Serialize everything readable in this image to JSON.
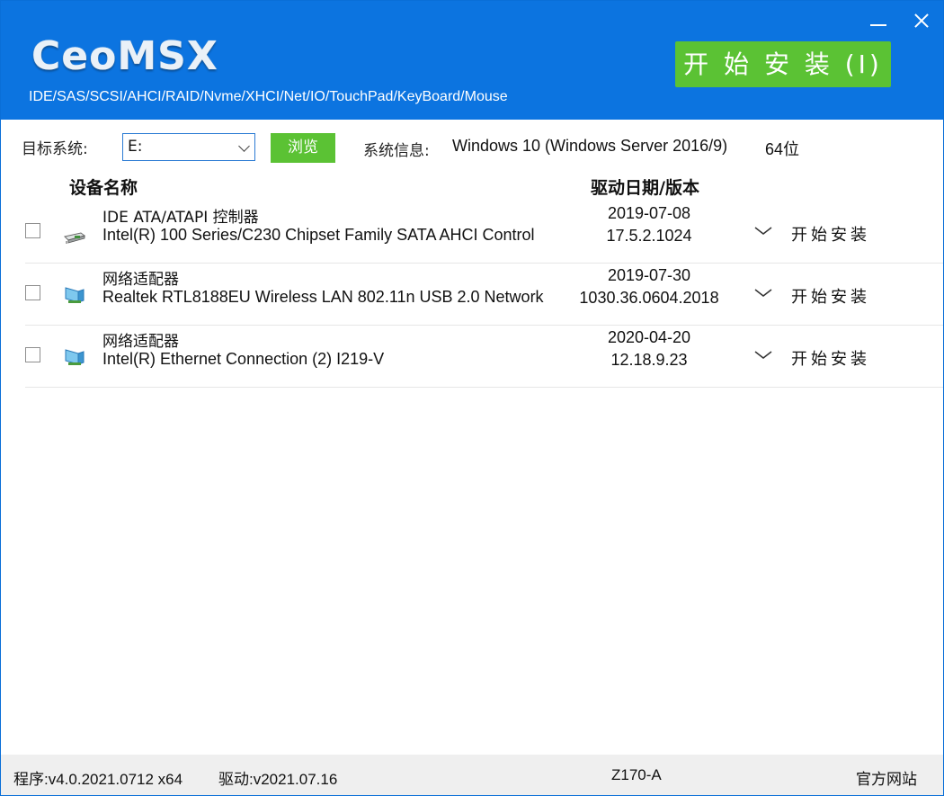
{
  "header": {
    "logo": "CeoMSX",
    "subtitle": "IDE/SAS/SCSI/AHCI/RAID/Nvme/XHCI/Net/IO/TouchPad/KeyBoard/Mouse",
    "install_label": "开 始 安 装 (I)"
  },
  "target": {
    "label": "目标系统:",
    "value": "E:",
    "browse_label": "浏览"
  },
  "system_info": {
    "label": "系统信息:",
    "os": "Windows 10 (Windows Server 2016/9)",
    "arch": "64位"
  },
  "table": {
    "col_name": "设备名称",
    "col_date_version": "驱动日期/版本",
    "rows": [
      {
        "category": "IDE ATA/ATAPI 控制器",
        "device": "Intel(R) 100 Series/C230 Chipset Family SATA AHCI Control",
        "date": "2019-07-08",
        "version": "17.5.2.1024",
        "install_label": "开始安装",
        "icon": "storage-controller-icon"
      },
      {
        "category": "网络适配器",
        "device": "Realtek RTL8188EU Wireless LAN 802.11n USB 2.0 Network",
        "date": "2019-07-30",
        "version": "1030.36.0604.2018",
        "install_label": "开始安装",
        "icon": "network-adapter-icon"
      },
      {
        "category": "网络适配器",
        "device": "Intel(R) Ethernet Connection (2) I219-V",
        "date": "2020-04-20",
        "version": "12.18.9.23",
        "install_label": "开始安装",
        "icon": "network-adapter-icon"
      }
    ]
  },
  "footer": {
    "program": "程序:v4.0.2021.0712 x64",
    "driver": "驱动:v2021.07.16",
    "board": "Z170-A",
    "site_link": "官方网站"
  },
  "colors": {
    "header_bg": "#0c74e0",
    "accent_green": "#5bc234",
    "footer_bg": "#efefef"
  }
}
